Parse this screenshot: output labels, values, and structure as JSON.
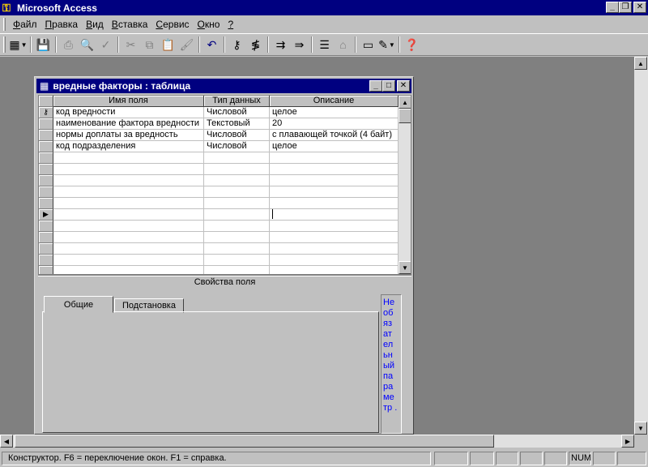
{
  "app": {
    "title": "Microsoft Access"
  },
  "menu": [
    {
      "label": "Файл",
      "key": "Ф",
      "rest": "айл"
    },
    {
      "label": "Правка",
      "key": "П",
      "rest": "равка"
    },
    {
      "label": "Вид",
      "key": "В",
      "rest": "ид"
    },
    {
      "label": "Вставка",
      "key": "В",
      "rest": "ставка"
    },
    {
      "label": "Сервис",
      "key": "С",
      "rest": "ервис"
    },
    {
      "label": "Окно",
      "key": "О",
      "rest": "кно"
    },
    {
      "label": "?",
      "key": "?",
      "rest": ""
    }
  ],
  "child_window": {
    "title": "вредные факторы : таблица"
  },
  "grid": {
    "columns": [
      "Имя поля",
      "Тип данных",
      "Описание"
    ],
    "rows": [
      {
        "name": "код вредности",
        "type": "Числовой",
        "desc": "целое",
        "key": true
      },
      {
        "name": "наименование фактора вредности",
        "type": "Текстовый",
        "desc": "20"
      },
      {
        "name": "нормы доплаты за вредность",
        "type": "Числовой",
        "desc": "с плавающей точкой (4 байт)"
      },
      {
        "name": "код подразделения",
        "type": "Числовой",
        "desc": "целое"
      }
    ]
  },
  "properties": {
    "label": "Свойства поля",
    "tabs": [
      "Общие",
      "Подстановка"
    ],
    "help_text": "Не об яз ат ел ьн ый па ра ме тр ."
  },
  "status": {
    "text": "Конструктор.  F6 = переключение окон.  F1 = справка.",
    "num": "NUM"
  },
  "colors": {
    "titlebar": "#000080",
    "face": "#c0c0c0",
    "mdi": "#808080",
    "help": "#0000ff"
  }
}
